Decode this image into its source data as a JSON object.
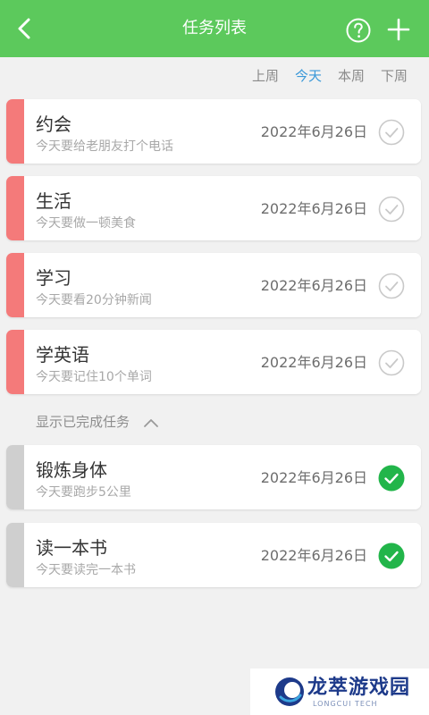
{
  "header": {
    "title": "任务列表"
  },
  "periods": [
    "上周",
    "今天",
    "本周",
    "下周"
  ],
  "active_period": "今天",
  "pending_tasks": [
    {
      "name": "约会",
      "desc": "今天要给老朋友打个电话",
      "date": "2022年6月26日"
    },
    {
      "name": "生活",
      "desc": "今天要做一顿美食",
      "date": "2022年6月26日"
    },
    {
      "name": "学习",
      "desc": "今天要看20分钟新闻",
      "date": "2022年6月26日"
    },
    {
      "name": "学英语",
      "desc": "今天要记住10个单词",
      "date": "2022年6月26日"
    }
  ],
  "completed_section": {
    "label": "显示已完成任务"
  },
  "completed_tasks": [
    {
      "name": "锻炼身体",
      "desc": "今天要跑步5公里",
      "date": "2022年6月26日"
    },
    {
      "name": "读一本书",
      "desc": "今天要读完一本书",
      "date": "2022年6月26日"
    }
  ],
  "watermark": {
    "brand": "龙萃游戏园",
    "sub": "LONGCUI TECH"
  },
  "colors": {
    "header": "#5cc95c",
    "accent": "#3a98d8",
    "pending_stripe": "#f47a7a",
    "done_stripe": "#cfcfcf",
    "done_check": "#22b54a"
  }
}
